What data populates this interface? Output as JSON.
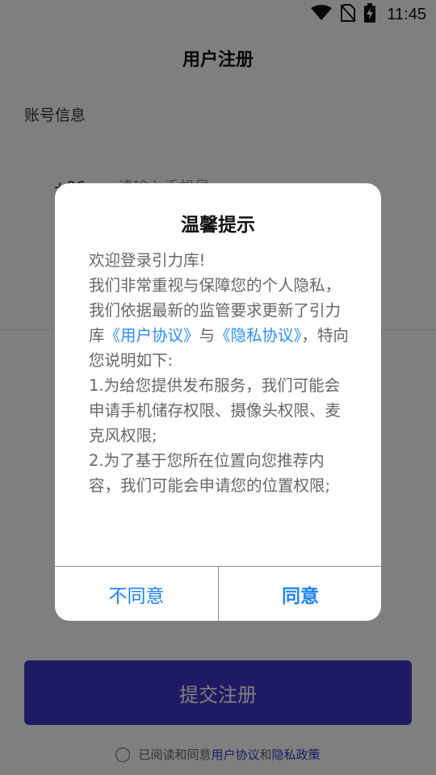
{
  "status_bar": {
    "time": "11:45",
    "icons": [
      "wifi-icon",
      "no-sim-icon",
      "battery-charging-icon"
    ]
  },
  "page": {
    "title": "用户注册",
    "section_label": "账号信息",
    "phone_prefix": "+86",
    "phone_placeholder": "请输入手机号",
    "submit_label": "提交注册",
    "agree_text": "已阅读和同意",
    "agree_link_user": "用户协议",
    "agree_and": "和",
    "agree_link_privacy": "隐私政策"
  },
  "dialog": {
    "title": "温馨提示",
    "greeting": "欢迎登录引力库!",
    "intro_before": "我们非常重视与保障您的个人隐私，我们依据最新的监管要求更新了引力库",
    "link_user_agreement": "《用户协议》",
    "intro_and": "与",
    "link_privacy": "《隐私协议》",
    "intro_after": "，特向您说明如下:",
    "item1": "1.为给您提供发布服务，我们可能会申请手机储存权限、摄像头权限、麦克风权限;",
    "item2": "2.为了基于您所在位置向您推荐内容，我们可能会申请您的位置权限;",
    "disagree_label": "不同意",
    "agree_label": "同意"
  },
  "colors": {
    "accent": "#3d37c9",
    "link": "#2b8cf2",
    "dialog_button": "#1f84f0"
  }
}
